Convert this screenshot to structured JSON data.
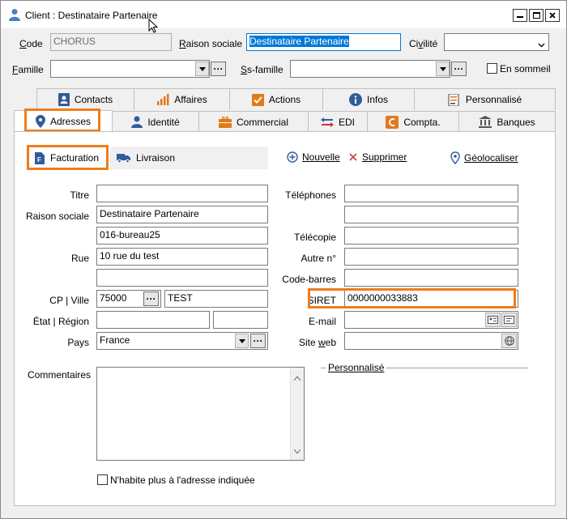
{
  "window": {
    "title": "Client : Destinataire Partenaire"
  },
  "header": {
    "code_label": "Code",
    "code_value": "CHORUS",
    "raison_label": "Raison sociale",
    "raison_value": "Destinataire Partenaire",
    "civilite_label": "Civilité",
    "civilite_value": "",
    "famille_label": "Famille",
    "famille_value": "",
    "sfamille_label": "Ss-famille",
    "sfamille_value": "",
    "sommeil_label": "En sommeil"
  },
  "tabs_row1": [
    {
      "label": "Contacts",
      "icon": "contact-card-icon"
    },
    {
      "label": "Affaires",
      "icon": "bar-chart-icon"
    },
    {
      "label": "Actions",
      "icon": "checkbox-icon"
    },
    {
      "label": "Infos",
      "icon": "info-icon"
    },
    {
      "label": "Personnalisé",
      "icon": "custom-list-icon"
    }
  ],
  "tabs_row2": [
    {
      "label": "Adresses",
      "icon": "location-pin-icon"
    },
    {
      "label": "Identité",
      "icon": "person-icon"
    },
    {
      "label": "Commercial",
      "icon": "briefcase-icon"
    },
    {
      "label": "EDI",
      "icon": "exchange-arrows-icon"
    },
    {
      "label": "Compta.",
      "icon": "accounting-icon"
    },
    {
      "label": "Banques",
      "icon": "bank-icon"
    }
  ],
  "addresses": {
    "facturation_label": "Facturation",
    "livraison_label": "Livraison",
    "nouvelle_label": "Nouvelle",
    "supprimer_label": "Supprimer",
    "geolocaliser_label": "Géolocaliser"
  },
  "form": {
    "titre_label": "Titre",
    "titre_value": "",
    "raison_label": "Raison sociale",
    "raison_value": "Destinataire Partenaire",
    "raison2_value": "016-bureau25",
    "rue_label": "Rue",
    "rue_value": "10 rue du test",
    "rue2_value": "",
    "cp_ville_label": "CP | Ville",
    "cp_value": "75000",
    "ville_value": "TEST",
    "etat_label": "État | Région",
    "etat_value": "",
    "region_value": "",
    "pays_label": "Pays",
    "pays_value": "France",
    "commentaires_label": "Commentaires",
    "nhabite_label": "N'habite plus à l'adresse indiquée",
    "telephones_label": "Téléphones",
    "telephone1_value": "",
    "telephone2_value": "",
    "telecopie_label": "Télécopie",
    "telecopie_value": "",
    "autre_label": "Autre n°",
    "autre_value": "",
    "codebarres_label": "Code-barres",
    "codebarres_value": "",
    "siret_label": "SIRET",
    "siret_value": "0000000033883",
    "email_label": "E-mail",
    "email_value": "",
    "siteweb_label": "Site web",
    "siteweb_value": "",
    "personnalise_label": "Personnalisé"
  },
  "colors": {
    "highlight": "#f07c1a",
    "selection": "#0078d7"
  }
}
